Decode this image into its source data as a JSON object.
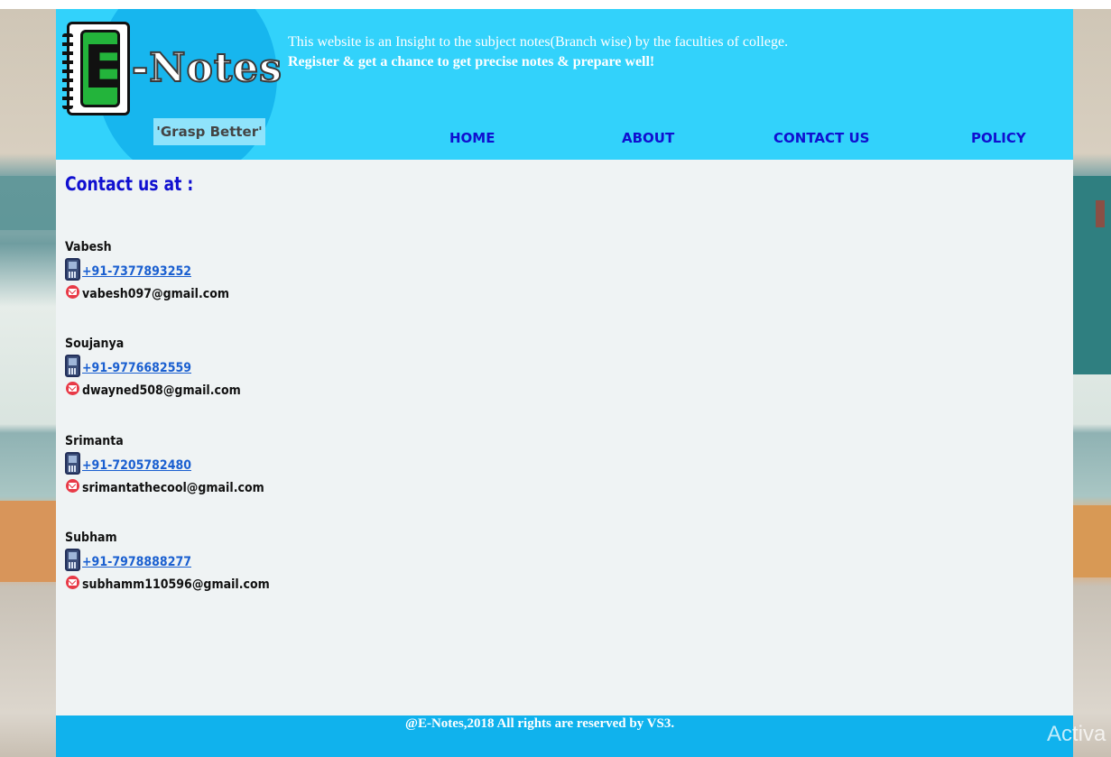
{
  "header": {
    "logo_letter": "E",
    "logo_word": "-Notes",
    "tagline": "'Grasp Better'",
    "intro_line1": "This website is an Insight to the subject notes(Branch wise) by the faculties of college.",
    "intro_line2": "Register & get a chance to get precise notes & prepare well!"
  },
  "nav": {
    "items": [
      {
        "label": "HOME"
      },
      {
        "label": "ABOUT"
      },
      {
        "label": "CONTACT US"
      },
      {
        "label": "POLICY"
      }
    ]
  },
  "main": {
    "heading": "Contact us at :",
    "contacts": [
      {
        "name": "Vabesh",
        "phone": "+91-7377893252",
        "email": "vabesh097@gmail.com"
      },
      {
        "name": "Soujanya",
        "phone": "+91-9776682559",
        "email": "dwayned508@gmail.com"
      },
      {
        "name": "Srimanta",
        "phone": "+91-7205782480",
        "email": "srimantathecool@gmail.com"
      },
      {
        "name": "Subham",
        "phone": "+91-7978888277",
        "email": "subhamm110596@gmail.com"
      }
    ]
  },
  "footer": {
    "text": "@E-Notes,2018 All rights are reserved by VS3."
  },
  "overlay": {
    "watermark": "Activa"
  },
  "colors": {
    "header_bg": "#32d2fb",
    "footer_bg": "#10b2ed",
    "nav_text": "#1010d0",
    "link": "#1a5fd0",
    "content_bg": "#eff3f4"
  },
  "icons": {
    "phone": "phone-icon",
    "mail": "mail-icon"
  }
}
